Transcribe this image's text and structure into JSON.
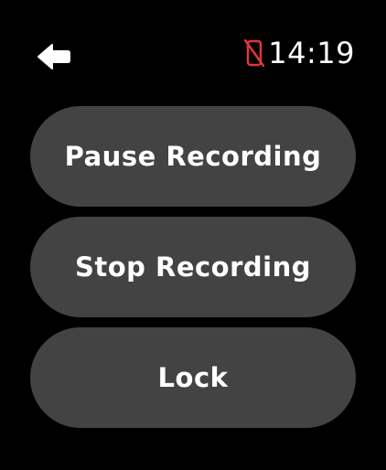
{
  "status_bar": {
    "time": "14:19",
    "phone_icon": "phone-disconnected-icon",
    "phone_icon_color": "#e0373a"
  },
  "header": {
    "back_icon": "back-arrow-icon"
  },
  "actions": [
    {
      "label": "Pause Recording"
    },
    {
      "label": "Stop Recording"
    },
    {
      "label": "Lock"
    }
  ],
  "colors": {
    "background": "#000000",
    "button_background": "#434343",
    "text": "#ffffff"
  }
}
